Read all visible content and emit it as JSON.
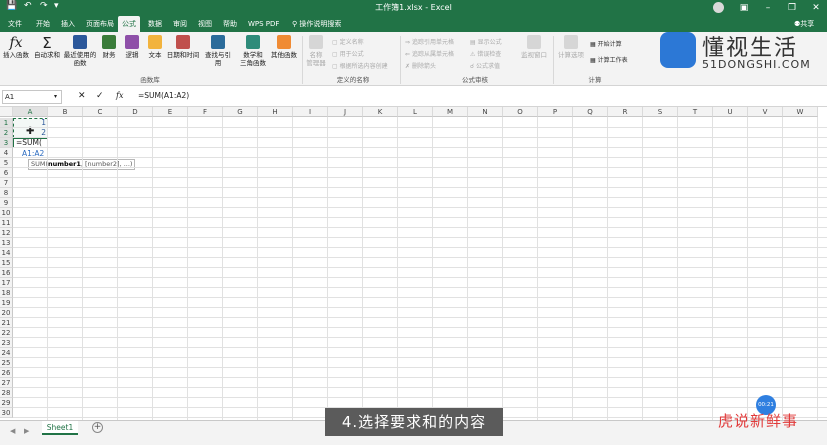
{
  "window": {
    "title": "工作簿1.xlsx - Excel",
    "share": "共享"
  },
  "tabs": [
    "文件",
    "开始",
    "插入",
    "页面布局",
    "公式",
    "数据",
    "审阅",
    "视图",
    "帮助",
    "WPS PDF"
  ],
  "tell_me": "操作说明搜索",
  "ribbon": {
    "insert_function": "插入函数",
    "autosum": "自动求和",
    "recent_l1": "最近使用的",
    "recent_l2": "函数",
    "financial": "财务",
    "logical": "逻辑",
    "text": "文本",
    "datetime": "日期和时间",
    "lookup": "查找与引用",
    "math_l1": "数学和",
    "math_l2": "三角函数",
    "more": "其他函数",
    "group_library": "函数库",
    "name_mgr_l1": "名称",
    "name_mgr_l2": "管理器",
    "define_name": "定义名称",
    "use_in_formula": "用于公式",
    "create_from_sel": "根据所选内容创建",
    "group_names": "定义的名称",
    "trace_precedents": "追踪引用单元格",
    "trace_dependents": "追踪从属单元格",
    "remove_arrows": "删除箭头",
    "show_formulas": "显示公式",
    "error_check": "错误检查",
    "eval_formula": "公式求值",
    "watch_window": "监视窗口",
    "group_audit": "公式审核",
    "calc_options": "计算选项",
    "calc_now": "开始计算",
    "calc_sheet": "计算工作表",
    "group_calc": "计算"
  },
  "formula_bar": {
    "name_box": "A1",
    "formula": "=SUM(A1:A2)"
  },
  "columns": [
    "A",
    "B",
    "C",
    "D",
    "E",
    "F",
    "G",
    "H",
    "I",
    "J",
    "K",
    "L",
    "M",
    "N",
    "O",
    "P",
    "Q",
    "R",
    "S",
    "T",
    "U",
    "V",
    "W"
  ],
  "rows": [
    "1",
    "2",
    "3",
    "4",
    "5",
    "6",
    "7",
    "8",
    "9",
    "10",
    "11",
    "12",
    "13",
    "14",
    "15",
    "16",
    "17",
    "18",
    "19",
    "20",
    "21",
    "22",
    "23",
    "24",
    "25",
    "26",
    "27",
    "28",
    "29",
    "30"
  ],
  "cells": {
    "a1": "1",
    "a2": "2",
    "a3": "=SUM(",
    "a4": "A1:A2"
  },
  "tooltip": {
    "fn": "SUM(",
    "arg1": "number1",
    "rest": ", [number2], ...)"
  },
  "sheet_tab": "Sheet1",
  "caption": "4.选择要求和的内容",
  "watermark": {
    "brand": "懂视生活",
    "url": "51DONGSHI.COM",
    "brand2": "虎说新鲜事",
    "timer": "00:21"
  }
}
